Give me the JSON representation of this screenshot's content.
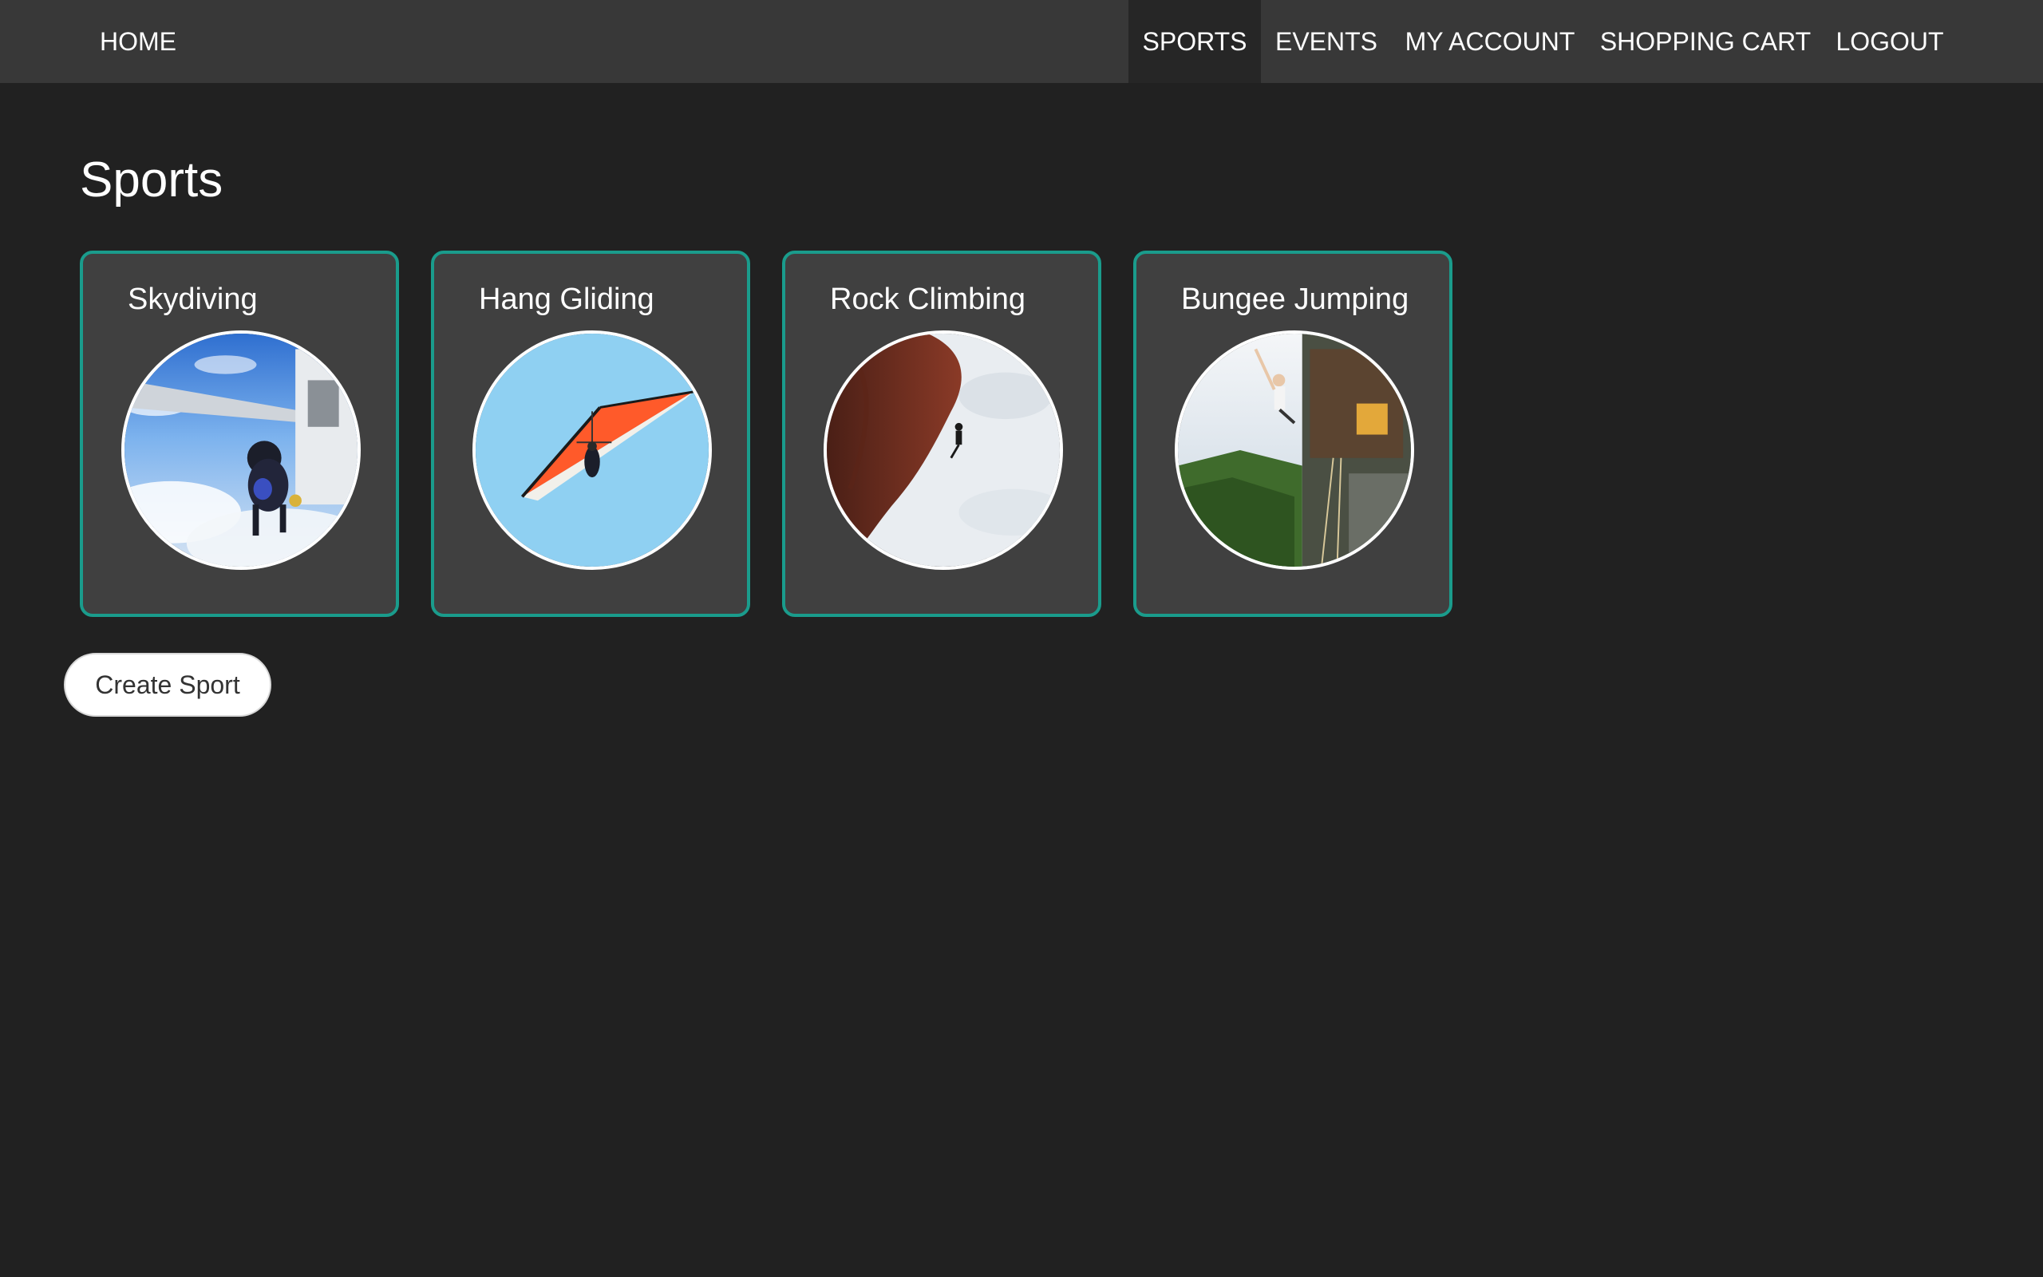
{
  "nav": {
    "home": "HOME",
    "sports": "SPORTS",
    "events": "EVENTS",
    "account": "MY ACCOUNT",
    "cart": "SHOPPING CART",
    "logout": "LOGOUT",
    "active": "sports"
  },
  "page": {
    "title": "Sports"
  },
  "sports": [
    {
      "name": "Skydiving",
      "image": "skydiving-photo"
    },
    {
      "name": "Hang Gliding",
      "image": "hang-gliding-photo"
    },
    {
      "name": "Rock Climbing",
      "image": "rock-climbing-photo"
    },
    {
      "name": "Bungee Jumping",
      "image": "bungee-jumping-photo"
    }
  ],
  "actions": {
    "create_label": "Create Sport"
  },
  "colors": {
    "background": "#212121",
    "navbar": "#383838",
    "card": "#404040",
    "card_border": "#1a9c8c"
  }
}
